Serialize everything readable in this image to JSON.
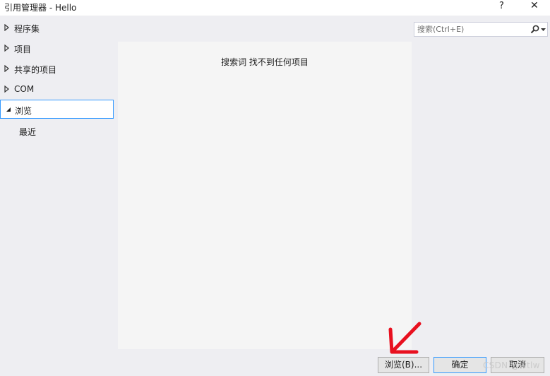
{
  "window": {
    "title": "引用管理器 - Hello",
    "help_label": "?",
    "close_label": "✕"
  },
  "sidebar": {
    "items": [
      {
        "label": "程序集"
      },
      {
        "label": "项目"
      },
      {
        "label": "共享的项目"
      },
      {
        "label": "COM"
      },
      {
        "label": "浏览",
        "selected": true
      },
      {
        "label": "最近"
      }
    ]
  },
  "search": {
    "placeholder": "搜索(Ctrl+E)",
    "value": ""
  },
  "results": {
    "message": "搜索词  找不到任何项目"
  },
  "buttons": {
    "browse": "浏览(B)...",
    "ok": "确定",
    "cancel": "取消"
  },
  "watermark": "CSDN @wtlw",
  "colors": {
    "accent": "#3399ff",
    "background": "#eeeef2",
    "panel": "#f5f5f5",
    "arrow": "#e8101f"
  }
}
